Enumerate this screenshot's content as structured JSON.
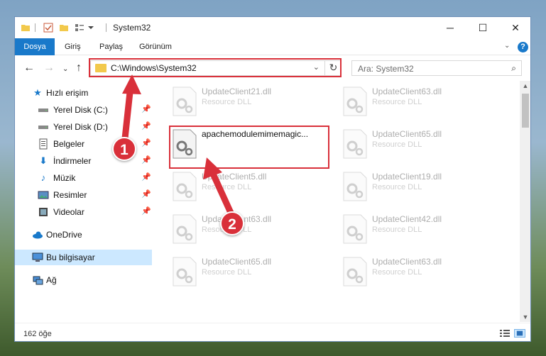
{
  "window": {
    "title": "System32",
    "controls": {
      "minimize": "─",
      "maximize": "☐",
      "close": "✕"
    }
  },
  "ribbon": {
    "tabs": [
      "Dosya",
      "Giriş",
      "Paylaş",
      "Görünüm"
    ],
    "help": "?"
  },
  "navigation": {
    "address": "C:\\Windows\\System32",
    "search_placeholder": "Ara: System32"
  },
  "sidebar": {
    "items": [
      {
        "label": "Hızlı erişim",
        "icon": "star-icon",
        "pinned": false
      },
      {
        "label": "Yerel Disk (C:)",
        "icon": "drive-icon",
        "pinned": true
      },
      {
        "label": "Yerel Disk (D:)",
        "icon": "drive-icon",
        "pinned": true
      },
      {
        "label": "Belgeler",
        "icon": "document-icon",
        "pinned": true
      },
      {
        "label": "İndirmeler",
        "icon": "download-icon",
        "pinned": true
      },
      {
        "label": "Müzik",
        "icon": "music-icon",
        "pinned": true
      },
      {
        "label": "Resimler",
        "icon": "pictures-icon",
        "pinned": true
      },
      {
        "label": "Videolar",
        "icon": "video-icon",
        "pinned": true
      },
      {
        "label": "OneDrive",
        "icon": "cloud-icon",
        "pinned": false
      },
      {
        "label": "Bu bilgisayar",
        "icon": "computer-icon",
        "pinned": false,
        "selected": true
      },
      {
        "label": "Ağ",
        "icon": "network-icon",
        "pinned": false
      }
    ]
  },
  "files": {
    "column1": [
      {
        "name": "UpdateClient21.dll",
        "type": "Resource DLL",
        "faded": true
      },
      {
        "name": "apachemodulemimemagic...",
        "type": "",
        "faded": false,
        "highlighted": true
      },
      {
        "name": "UpdateClient5.dll",
        "type": "Resource DLL",
        "faded": true
      },
      {
        "name": "UpdateClient63.dll",
        "type": "Resource DLL",
        "faded": true
      },
      {
        "name": "UpdateClient65.dll",
        "type": "Resource DLL",
        "faded": true
      }
    ],
    "column2": [
      {
        "name": "UpdateClient63.dll",
        "type": "Resource DLL",
        "faded": true
      },
      {
        "name": "UpdateClient65.dll",
        "type": "Resource DLL",
        "faded": true
      },
      {
        "name": "UpdateClient19.dll",
        "type": "Resource DLL",
        "faded": true
      },
      {
        "name": "UpdateClient42.dll",
        "type": "Resource DLL",
        "faded": true
      },
      {
        "name": "UpdateClient63.dll",
        "type": "Resource DLL",
        "faded": true
      }
    ]
  },
  "status": {
    "item_count": "162 öğe"
  },
  "callouts": [
    "1",
    "2"
  ],
  "colors": {
    "accent": "#1979ca",
    "highlight_box": "#d9303a",
    "selected_bg": "#cce8ff"
  }
}
